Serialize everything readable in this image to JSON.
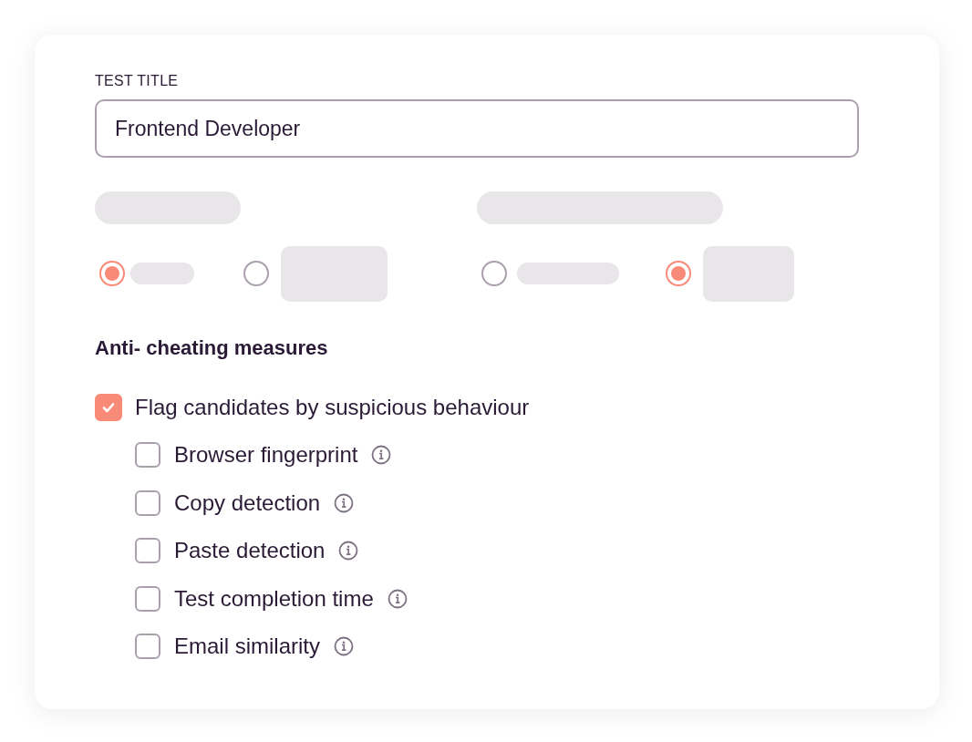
{
  "test_title": {
    "label": "TEST TITLE",
    "value": "Frontend Developer"
  },
  "radio_groups": [
    {
      "options": [
        {
          "selected": true,
          "kind": "bar"
        },
        {
          "selected": false,
          "kind": "block"
        }
      ]
    },
    {
      "options": [
        {
          "selected": false,
          "kind": "bar"
        },
        {
          "selected": true,
          "kind": "block"
        }
      ]
    }
  ],
  "anti_cheating": {
    "heading": "Anti- cheating measures",
    "main": {
      "label": "Flag candidates by suspicious behaviour",
      "checked": true
    },
    "items": [
      {
        "label": "Browser fingerprint",
        "checked": false
      },
      {
        "label": "Copy detection",
        "checked": false
      },
      {
        "label": "Paste detection",
        "checked": false
      },
      {
        "label": "Test completion time",
        "checked": false
      },
      {
        "label": "Email similarity",
        "checked": false
      }
    ]
  }
}
